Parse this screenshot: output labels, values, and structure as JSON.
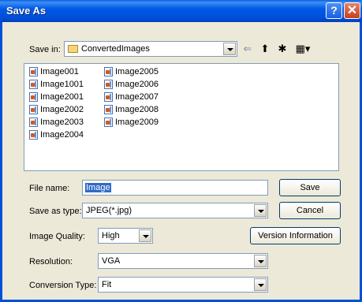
{
  "window": {
    "title": "Save As",
    "help_glyph": "?",
    "close_glyph": "✕"
  },
  "savein": {
    "label": "Save in:",
    "folder": "ConvertedImages",
    "tools": {
      "back": "⇐",
      "up": "⬆",
      "new_folder": "✱",
      "view": "▦▾"
    }
  },
  "files": {
    "column1": [
      "Image001",
      "Image1001",
      "Image2001",
      "Image2002",
      "Image2003",
      "Image2004"
    ],
    "column2": [
      "Image2005",
      "Image2006",
      "Image2007",
      "Image2008",
      "Image2009"
    ]
  },
  "filename": {
    "label": "File name:",
    "value": "Image"
  },
  "savetype": {
    "label": "Save as type:",
    "value": "JPEG(*.jpg)"
  },
  "quality": {
    "label": "Image Quality:",
    "value": "High"
  },
  "resolution": {
    "label": "Resolution:",
    "value": "VGA"
  },
  "conversion": {
    "label": "Conversion Type:",
    "value": "Fit"
  },
  "buttons": {
    "save": "Save",
    "cancel": "Cancel",
    "version": "Version Information"
  }
}
